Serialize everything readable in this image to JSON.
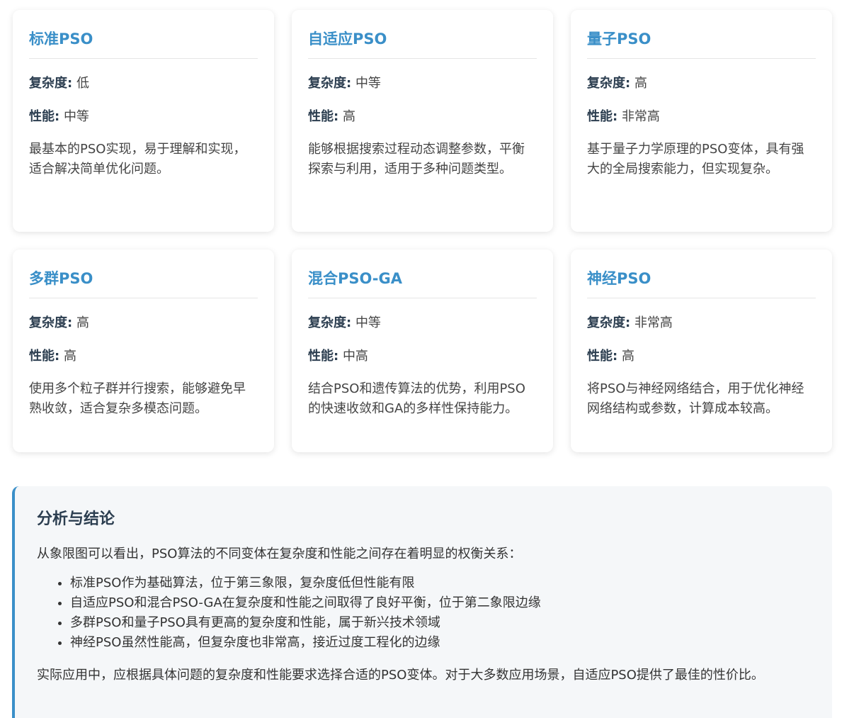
{
  "labels": {
    "complexity": "复杂度:",
    "performance": "性能:"
  },
  "cards": [
    {
      "title": "标准PSO",
      "complexity": "低",
      "performance": "中等",
      "description": "最基本的PSO实现，易于理解和实现，适合解决简单优化问题。"
    },
    {
      "title": "自适应PSO",
      "complexity": "中等",
      "performance": "高",
      "description": "能够根据搜索过程动态调整参数，平衡探索与利用，适用于多种问题类型。"
    },
    {
      "title": "量子PSO",
      "complexity": "高",
      "performance": "非常高",
      "description": "基于量子力学原理的PSO变体，具有强大的全局搜索能力，但实现复杂。"
    },
    {
      "title": "多群PSO",
      "complexity": "高",
      "performance": "高",
      "description": "使用多个粒子群并行搜索，能够避免早熟收敛，适合复杂多模态问题。"
    },
    {
      "title": "混合PSO-GA",
      "complexity": "中等",
      "performance": "中高",
      "description": "结合PSO和遗传算法的优势，利用PSO的快速收敛和GA的多样性保持能力。"
    },
    {
      "title": "神经PSO",
      "complexity": "非常高",
      "performance": "高",
      "description": "将PSO与神经网络结合，用于优化神经网络结构或参数，计算成本较高。"
    }
  ],
  "analysis": {
    "title": "分析与结论",
    "intro": "从象限图可以看出，PSO算法的不同变体在复杂度和性能之间存在着明显的权衡关系：",
    "points": [
      "标准PSO作为基础算法，位于第三象限，复杂度低但性能有限",
      "自适应PSO和混合PSO-GA在复杂度和性能之间取得了良好平衡，位于第二象限边缘",
      "多群PSO和量子PSO具有更高的复杂度和性能，属于新兴技术领域",
      "神经PSO虽然性能高，但复杂度也非常高，接近过度工程化的边缘"
    ],
    "conclusion": "实际应用中，应根据具体问题的复杂度和性能要求选择合适的PSO变体。对于大多数应用场景，自适应PSO提供了最佳的性价比。"
  }
}
